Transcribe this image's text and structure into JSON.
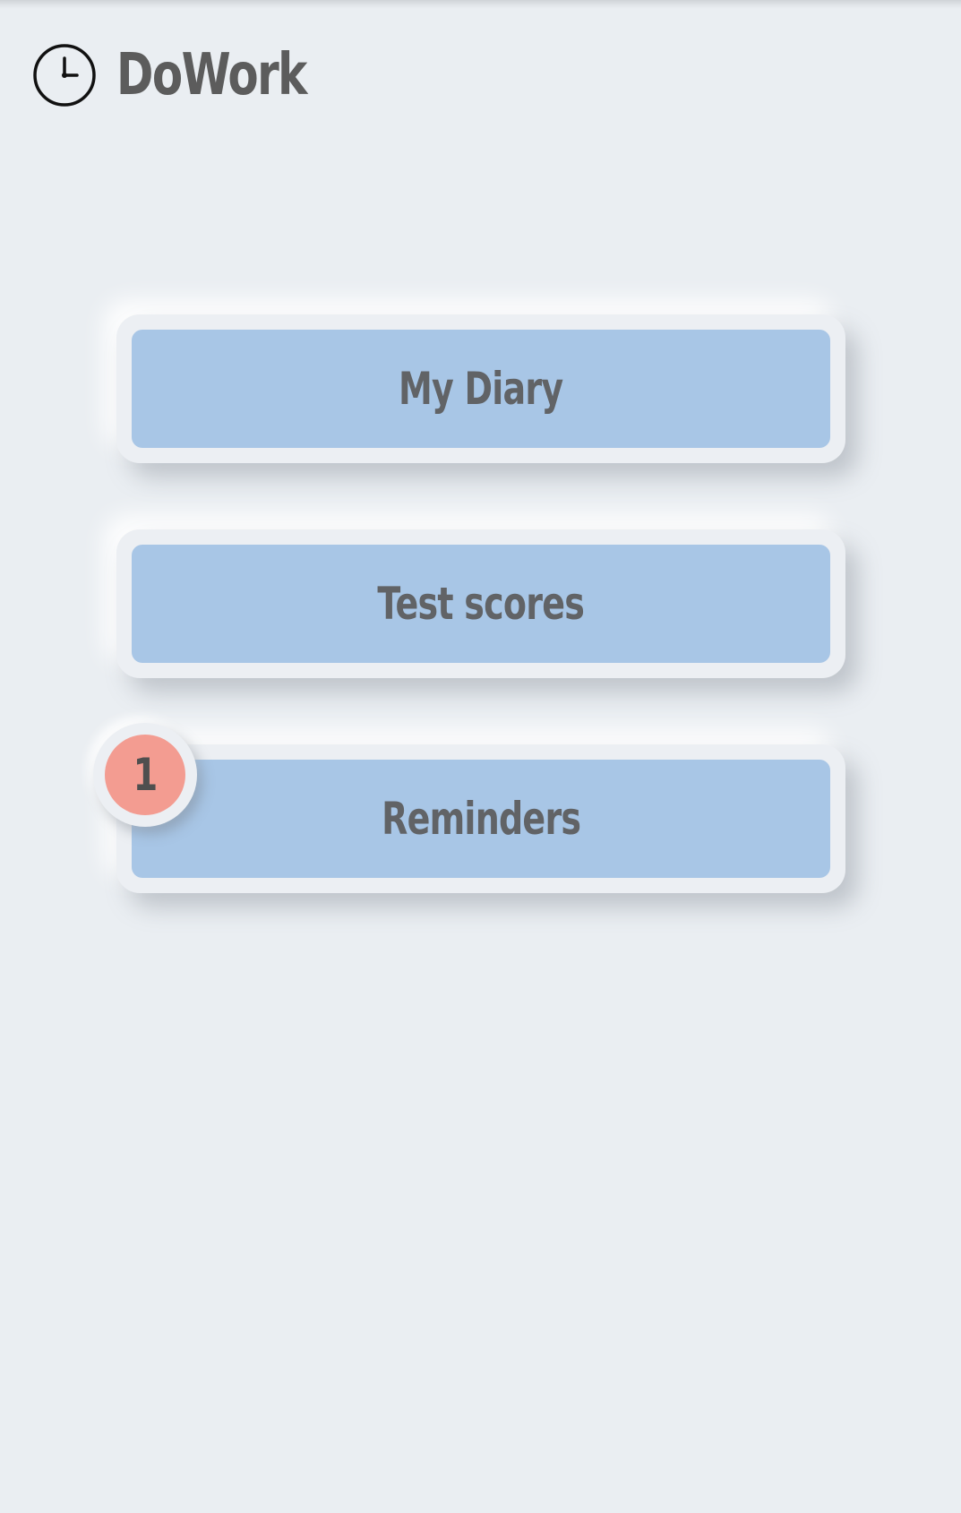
{
  "app": {
    "title": "DoWork",
    "icon": "clock-icon"
  },
  "menu": {
    "items": [
      {
        "label": "My Diary"
      },
      {
        "label": "Test scores"
      },
      {
        "label": "Reminders",
        "badge_count": "1"
      }
    ]
  },
  "colors": {
    "background": "#eaeef2",
    "button_fill": "#a8c6e6",
    "badge_fill": "#f39c91",
    "text": "#5c5c5c"
  }
}
